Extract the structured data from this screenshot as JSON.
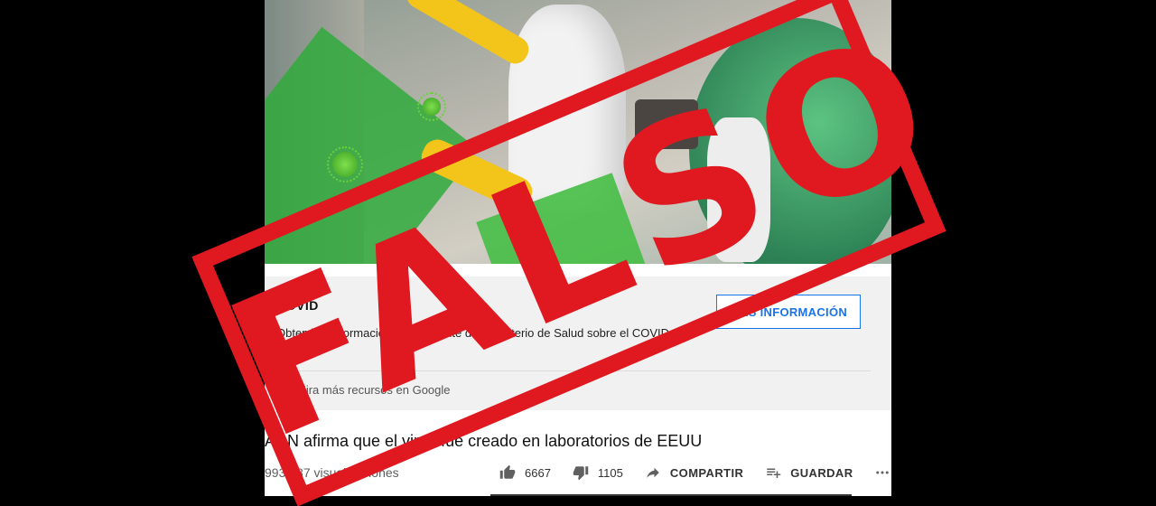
{
  "info_panel": {
    "title": "COVID",
    "body": "Obtené la información más reciente del Ministerio de Salud sobre el COVID-19.",
    "button_label": "MÁS INFORMACIÓN",
    "link_text": "Mira más recursos en Google"
  },
  "video": {
    "title": "ADN afirma que el virus fue creado en laboratorios de EEUU",
    "views": "993.087 visualizaciones",
    "likes": "6667",
    "dislikes": "1105",
    "share_label": "COMPARTIR",
    "save_label": "GUARDAR"
  },
  "stamp": {
    "text": "FALSO",
    "color": "#e01820"
  },
  "icons": [
    "thumbs-up-icon",
    "thumbs-down-icon",
    "share-icon",
    "playlist-add-icon",
    "more-icon",
    "google-icon"
  ]
}
